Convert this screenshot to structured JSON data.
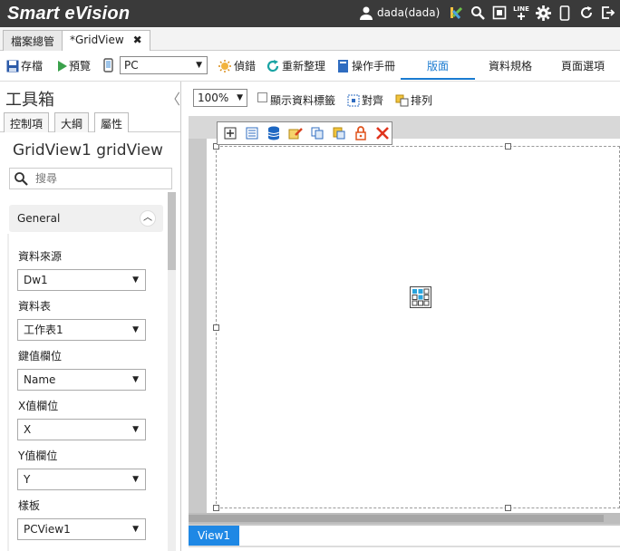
{
  "header": {
    "brand": "Smart eVision",
    "user": "dada(dada)",
    "icons": [
      "user-icon",
      "chart-icon",
      "search-icon",
      "fullscreen-icon",
      "line-icon",
      "gear-icon",
      "mobile-icon",
      "refresh-icon",
      "logout-icon"
    ],
    "line_text": "LINE"
  },
  "doc_tabs": [
    {
      "label": "檔案總管"
    },
    {
      "label": "*GridView",
      "close": "✖"
    }
  ],
  "toolbar": {
    "save": "存檔",
    "preview": "預覽",
    "device": "PC",
    "debug": "偵錯",
    "reorg": "重新整理",
    "manual": "操作手冊",
    "views": [
      "版面",
      "資料規格",
      "頁面選項"
    ]
  },
  "left": {
    "title": "工具箱",
    "collapse": "〈",
    "tabs": [
      "控制項",
      "大綱",
      "屬性"
    ],
    "component": "GridView1 gridView",
    "search_placeholder": "搜尋",
    "group": "General",
    "props": [
      {
        "label": "資料來源",
        "value": "Dw1"
      },
      {
        "label": "資料表",
        "value": "工作表1"
      },
      {
        "label": "鍵值欄位",
        "value": "Name"
      },
      {
        "label": "X值欄位",
        "value": "X"
      },
      {
        "label": "Y值欄位",
        "value": "Y"
      },
      {
        "label": "樣板",
        "value": "PCView1"
      }
    ]
  },
  "design": {
    "zoom": "100%",
    "show_labels": "顯示資料標籤",
    "align": "對齊",
    "arrange": "排列"
  },
  "bottom_tab": "View1",
  "colors": {
    "accent": "#1a7bd1",
    "header": "#3a3a3a",
    "tab_blue": "#1e88e5"
  }
}
